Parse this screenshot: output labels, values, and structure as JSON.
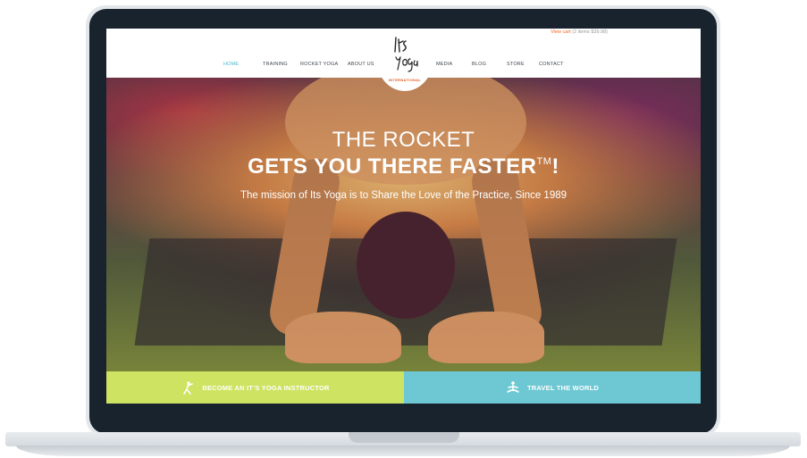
{
  "site": {
    "cart": {
      "link": "View cart",
      "detail": "(2 items $39.98)"
    },
    "logo": {
      "sub": "INTERNATIONAL"
    },
    "nav": [
      {
        "label": "HOME",
        "active": true
      },
      {
        "label": "TRAINING"
      },
      {
        "label": "ROCKET YOGA"
      },
      {
        "label": "ABOUT US"
      },
      {
        "label": "MEDIA"
      },
      {
        "label": "BLOG"
      },
      {
        "label": "STORE"
      },
      {
        "label": "CONTACT"
      }
    ],
    "hero": {
      "line1": "THE ROCKET",
      "line2": "GETS YOU THERE FASTER",
      "tm": "TM",
      "excl": "!",
      "subtitle": "The mission of Its Yoga is to Share the Love of the Practice, Since 1989"
    },
    "cta": {
      "left": {
        "label": "BECOME AN IT’S YOGA INSTRUCTOR",
        "icon": "yoga-pose-icon",
        "color": "#cde361"
      },
      "right": {
        "label": "TRAVEL THE WORLD",
        "icon": "meditation-icon",
        "color": "#6ec8d3"
      }
    }
  },
  "colors": {
    "accent_active": "#4eb6cf",
    "cart_link": "#f26522",
    "logo_sub": "#e25b20"
  }
}
